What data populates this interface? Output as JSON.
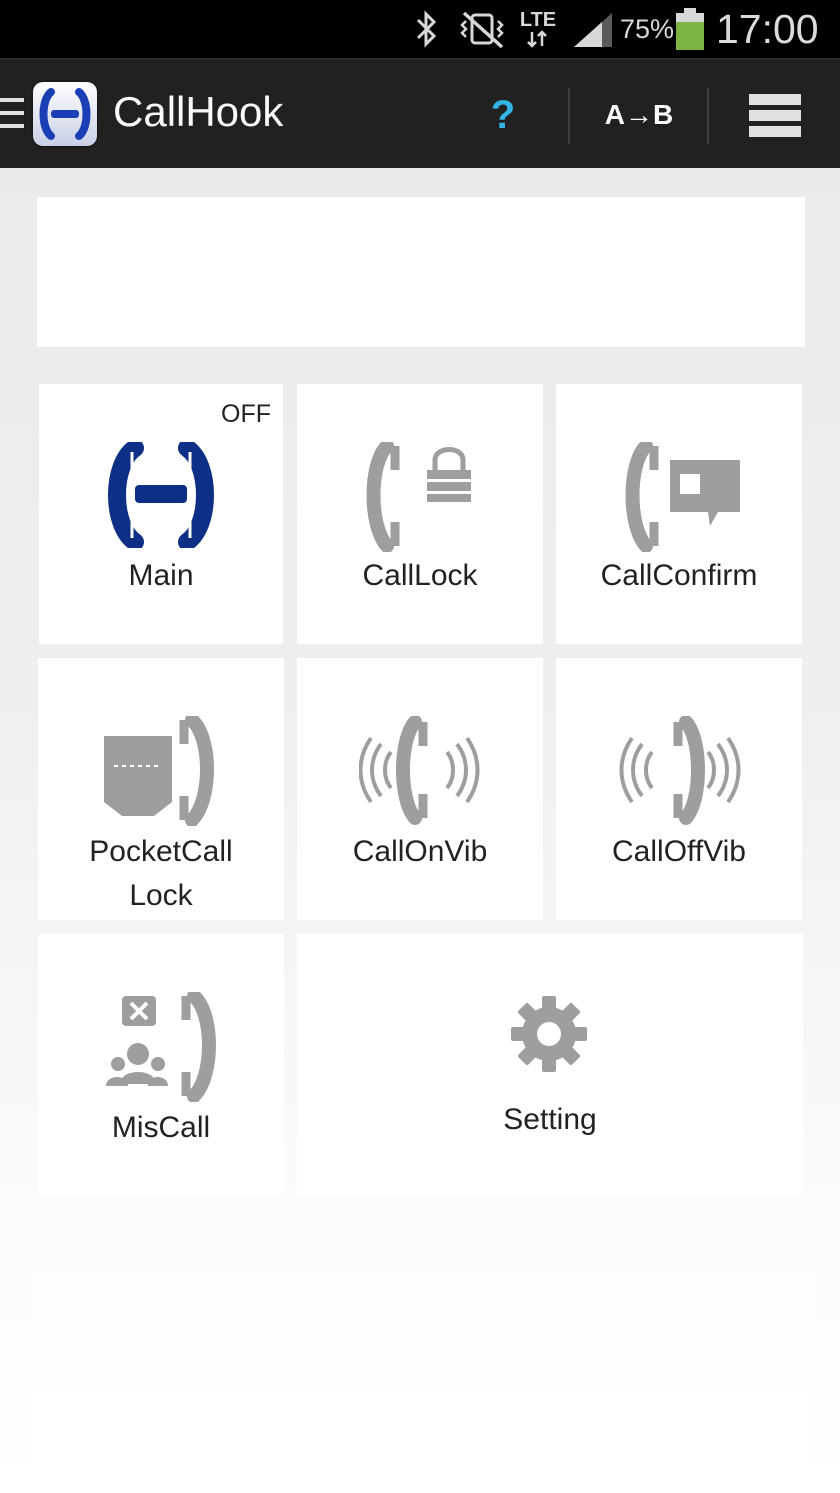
{
  "status_bar": {
    "icons": [
      "bluetooth-icon",
      "vibrate-mute-icon",
      "lte-data-icon",
      "signal-icon",
      "battery-icon"
    ],
    "network_label": "LTE",
    "battery_percent": "75%",
    "time": "17:00",
    "battery_color": "#7cb342"
  },
  "action_bar": {
    "title": "CallHook",
    "help_label": "?",
    "ab_label": "A→B",
    "accent": "#33b5e5"
  },
  "tiles": {
    "main": {
      "label": "Main",
      "badge": "OFF",
      "icon": "callhook-logo-icon",
      "color": "#0d2f86"
    },
    "calllock": {
      "label": "CallLock",
      "icon": "phone-lock-icon"
    },
    "callconfirm": {
      "label": "CallConfirm",
      "icon": "phone-confirm-icon"
    },
    "pocketcalllock": {
      "label_line1": "PocketCall",
      "label_line2": "Lock",
      "icon": "pocket-phone-icon"
    },
    "callonvib": {
      "label": "CallOnVib",
      "icon": "phone-vibrate-on-icon"
    },
    "calloffvib": {
      "label": "CallOffVib",
      "icon": "phone-vibrate-off-icon"
    },
    "miscall": {
      "label": "MisCall",
      "icon": "missed-call-icon"
    },
    "setting": {
      "label": "Setting",
      "icon": "gear-icon"
    }
  },
  "colors": {
    "icon_gray": "#9e9e9e"
  }
}
